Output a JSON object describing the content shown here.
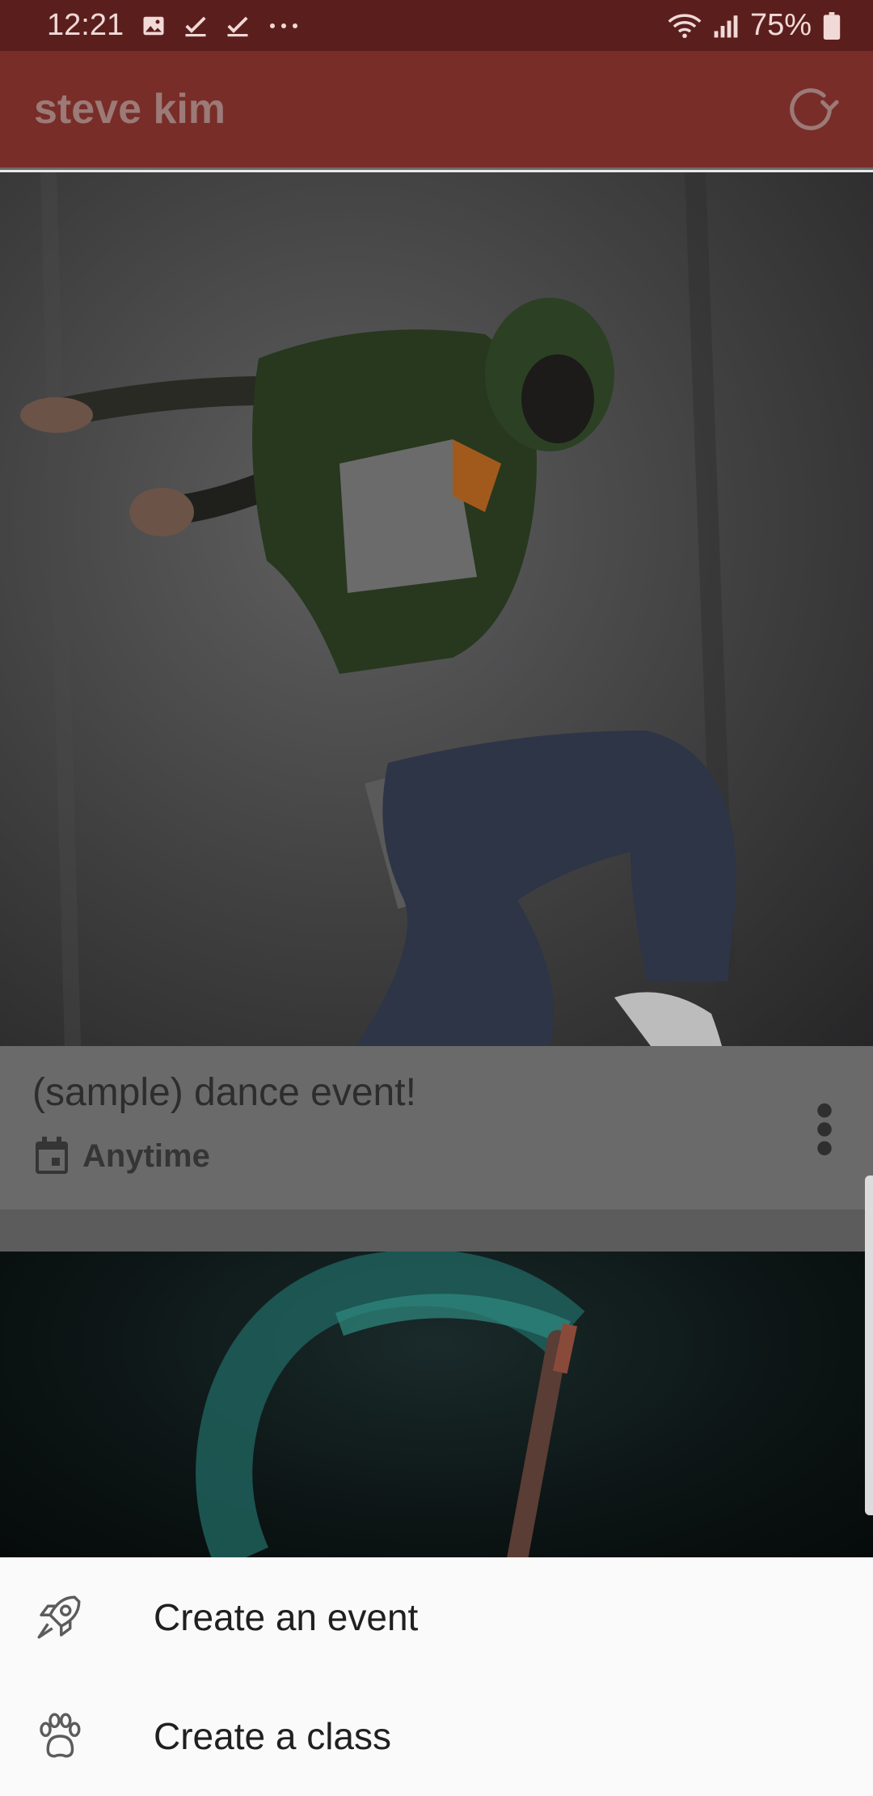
{
  "status_bar": {
    "time": "12:21",
    "battery": "75%",
    "left_icons": [
      "image-icon",
      "check-icon",
      "check-icon",
      "more-dots-icon"
    ],
    "right_icons": [
      "wifi-icon",
      "signal-icon",
      "battery-icon"
    ]
  },
  "app_bar": {
    "title": "steve kim",
    "action_icon": "refresh-icon",
    "color": "#792d28"
  },
  "feed": {
    "cards": [
      {
        "title": "(sample) dance event!",
        "date_icon": "calendar-icon",
        "date": "Anytime",
        "menu_icon": "more-vert-icon"
      }
    ]
  },
  "bottom_sheet": {
    "items": [
      {
        "label": "Create an event",
        "icon": "rocket-icon"
      },
      {
        "label": "Create a class",
        "icon": "paw-icon"
      }
    ]
  }
}
